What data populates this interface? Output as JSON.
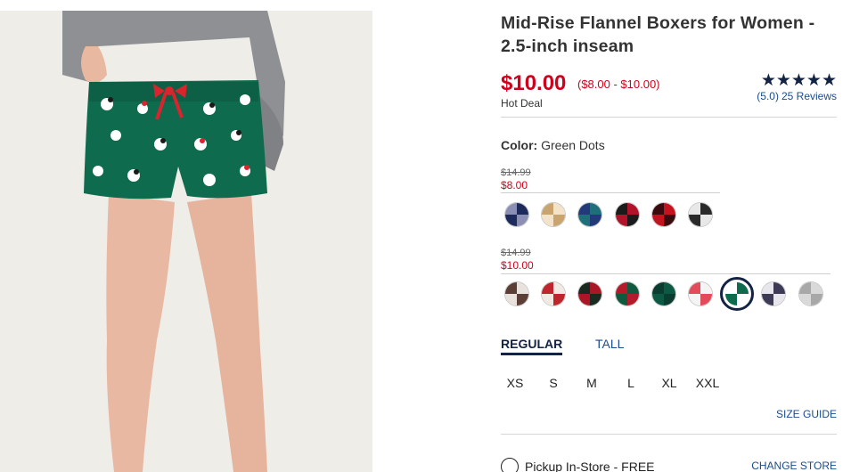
{
  "product": {
    "title": "Mid-Rise Flannel Boxers for Women - 2.5-inch inseam",
    "price": "$10.00",
    "price_range": "($8.00 - $10.00)",
    "deal_label": "Hot Deal",
    "rating": {
      "stars_text": "★★★★★",
      "score": "(5.0)",
      "reviews": "25 Reviews"
    }
  },
  "color": {
    "label": "Color:",
    "value": "Green Dots"
  },
  "swatch_groups": [
    {
      "old_price": "$14.99",
      "new_price": "$8.00",
      "swatches": [
        {
          "name": "navy-plaid",
          "colors": [
            "#1d2a5c",
            "#8a8fb3"
          ]
        },
        {
          "name": "leopard",
          "colors": [
            "#f3e3c8",
            "#c9a46f"
          ]
        },
        {
          "name": "blue-teal-plaid",
          "colors": [
            "#1f6f7a",
            "#223a7a"
          ]
        },
        {
          "name": "red-black-plaid",
          "colors": [
            "#b1142a",
            "#1b1b1b"
          ]
        },
        {
          "name": "red-buffalo-check",
          "colors": [
            "#c5121f",
            "#3a0a0f"
          ]
        },
        {
          "name": "black-white-check",
          "colors": [
            "#2a2a2a",
            "#e8e8e8"
          ]
        }
      ]
    },
    {
      "old_price": "$14.99",
      "new_price": "$10.00",
      "swatches": [
        {
          "name": "dog-print",
          "colors": [
            "#e9e2dc",
            "#5b3e36"
          ]
        },
        {
          "name": "santa-print",
          "colors": [
            "#f2e9e2",
            "#c0242c"
          ]
        },
        {
          "name": "red-tartan",
          "colors": [
            "#a91625",
            "#1a2a20"
          ]
        },
        {
          "name": "green-tartan",
          "colors": [
            "#0f5a3e",
            "#b51a2a"
          ]
        },
        {
          "name": "green-check",
          "colors": [
            "#0c5a44",
            "#0a3d30"
          ]
        },
        {
          "name": "multi-dots",
          "colors": [
            "#f4f4f4",
            "#e34a5a"
          ]
        },
        {
          "name": "green-dots",
          "colors": [
            "#0f6b4e",
            "#ffffff"
          ],
          "selected": true
        },
        {
          "name": "polar-bear",
          "colors": [
            "#3c3a54",
            "#e6e6ec"
          ]
        },
        {
          "name": "grey-print",
          "colors": [
            "#d9d9d9",
            "#a8a8a8"
          ]
        }
      ]
    }
  ],
  "fit_tabs": [
    {
      "label": "REGULAR",
      "active": true
    },
    {
      "label": "TALL",
      "active": false
    }
  ],
  "sizes": [
    "XS",
    "S",
    "M",
    "L",
    "XL",
    "XXL"
  ],
  "size_guide": "SIZE GUIDE",
  "pickup": {
    "label": "Pickup In-Store - FREE",
    "change_store": "CHANGE STORE"
  },
  "colors": {
    "sale_red": "#d0021b",
    "navy": "#122344",
    "link_blue": "#1c4c8c",
    "short_green": "#0f6b4e"
  }
}
